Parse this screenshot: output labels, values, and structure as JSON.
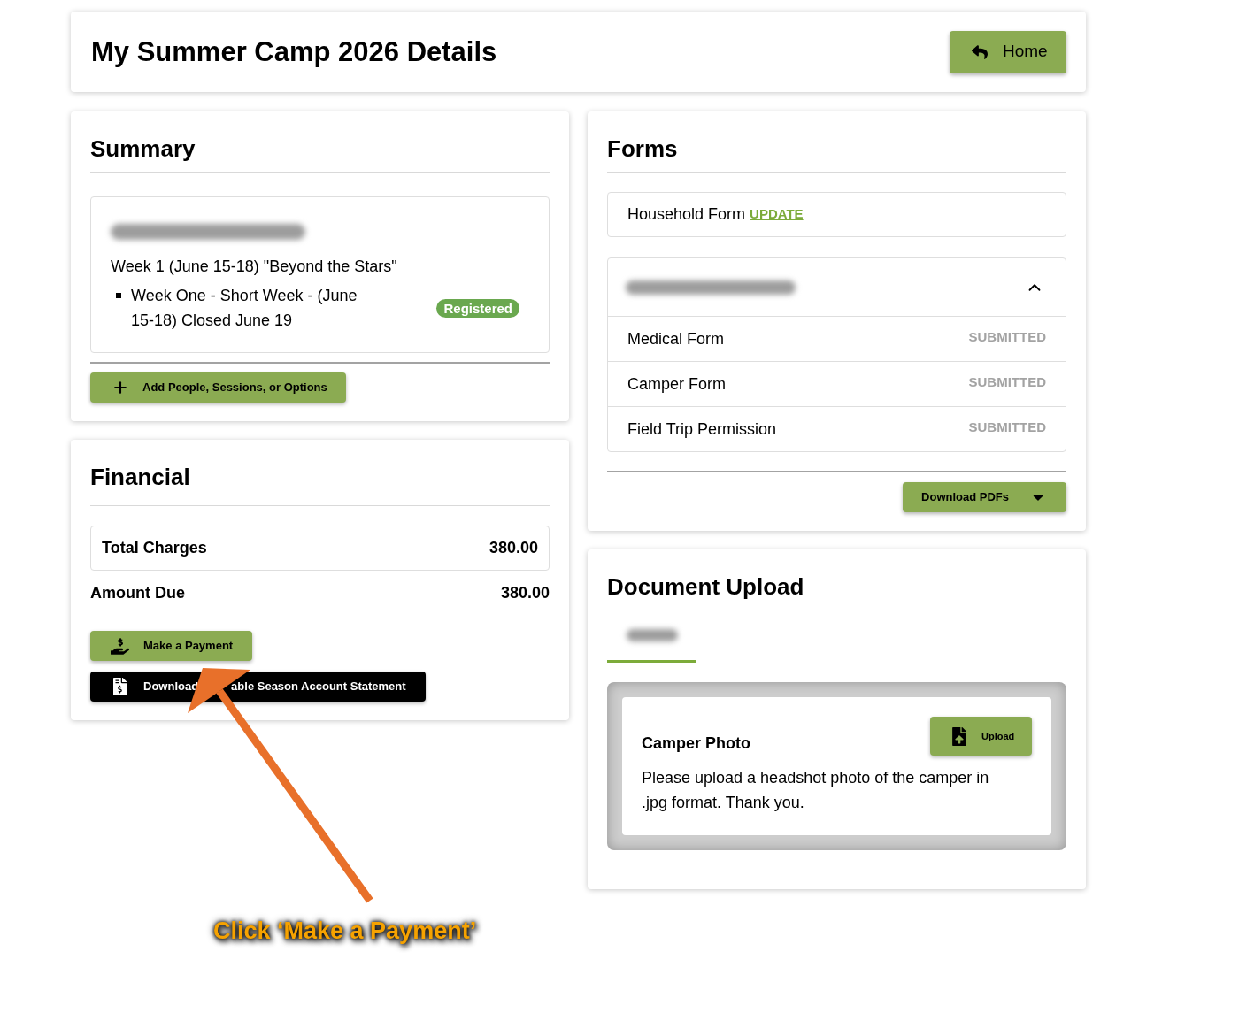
{
  "page_header": {
    "title": "My Summer Camp 2026 Details",
    "home_button": "Home"
  },
  "summary": {
    "title": "Summary",
    "session_link": "Week 1 (June 15-18) \"Beyond the Stars\"",
    "items": [
      {
        "text": "Week One - Short Week - (June 15-18) Closed June 19",
        "status": "Registered"
      }
    ],
    "add_button": "Add People, Sessions, or Options"
  },
  "financial": {
    "title": "Financial",
    "rows": [
      {
        "kind": "boxed",
        "label": "Total Charges",
        "value": "380.00"
      },
      {
        "kind": "plain",
        "label": "Amount Due",
        "value": "380.00"
      }
    ],
    "buttons": [
      {
        "kind": "primary",
        "label": "Make a Payment"
      },
      {
        "kind": "dark",
        "label": "Download",
        "label_after_arrow": "able Season Account Statement"
      }
    ]
  },
  "forms": {
    "title": "Forms",
    "household": {
      "label": "Household Form",
      "link": "UPDATE"
    },
    "accordion": {
      "expanded": true,
      "items": [
        {
          "label": "Medical Form",
          "status": "SUBMITTED"
        },
        {
          "label": "Camper Form",
          "status": "SUBMITTED"
        },
        {
          "label": "Field Trip Permission",
          "status": "SUBMITTED"
        }
      ]
    },
    "download_button": "Download PDFs"
  },
  "document_upload": {
    "title": "Document Upload",
    "tabs": [
      {
        "selected": true
      }
    ],
    "documents": [
      {
        "title": "Camper Photo",
        "description": "Please upload a headshot photo of the camper in .jpg format. Thank you.",
        "button": "Upload"
      }
    ]
  },
  "annotation": {
    "caption": "Click ‘Make a Payment’"
  }
}
